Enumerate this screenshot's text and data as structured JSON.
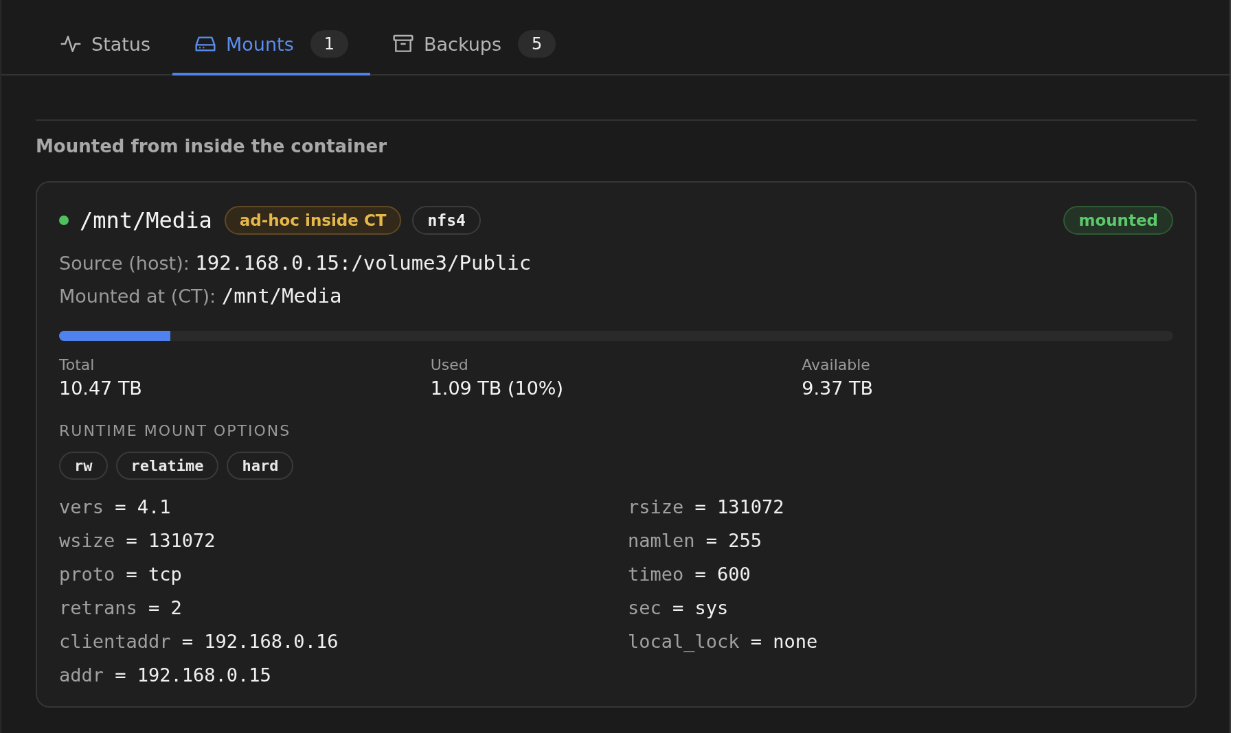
{
  "tabs": [
    {
      "label": "Status",
      "selected": false
    },
    {
      "label": "Mounts",
      "count": "1",
      "selected": true
    },
    {
      "label": "Backups",
      "count": "5",
      "selected": false
    }
  ],
  "section": {
    "heading": "Mounted from inside the container"
  },
  "mount": {
    "color": "#4fc15e",
    "path": "/mnt/Media",
    "tags": [
      {
        "label": "ad-hoc inside CT",
        "kind": "origin"
      },
      {
        "label": "nfs4",
        "kind": "plain"
      }
    ],
    "state": "mounted",
    "source_label": "Source (host):",
    "source": "192.168.0.15:/volume3/Public",
    "target_label": "Mounted at (CT):",
    "target": "/mnt/Media",
    "usage": {
      "level": 0.1
    },
    "stats": [
      {
        "label": "Total",
        "value": "10.47 TB"
      },
      {
        "label": "Used",
        "value": "1.09 TB (10%)"
      },
      {
        "label": "Available",
        "value": "9.37 TB"
      }
    ],
    "options_heading": "RUNTIME MOUNT OPTIONS",
    "flags": [
      "rw",
      "relatime",
      "hard"
    ],
    "options": [
      {
        "key": "vers",
        "value": "= 4.1"
      },
      {
        "key": "rsize",
        "value": "= 131072"
      },
      {
        "key": "wsize",
        "value": "= 131072"
      },
      {
        "key": "namlen",
        "value": "= 255"
      },
      {
        "key": "proto",
        "value": "= tcp"
      },
      {
        "key": "timeo",
        "value": "= 600"
      },
      {
        "key": "retrans",
        "value": "= 2"
      },
      {
        "key": "sec",
        "value": "= sys"
      },
      {
        "key": "clientaddr",
        "value": "= 192.168.0.16"
      },
      {
        "key": "local_lock",
        "value": "= none"
      },
      {
        "key": "addr",
        "value": "= 192.168.0.15"
      }
    ]
  }
}
